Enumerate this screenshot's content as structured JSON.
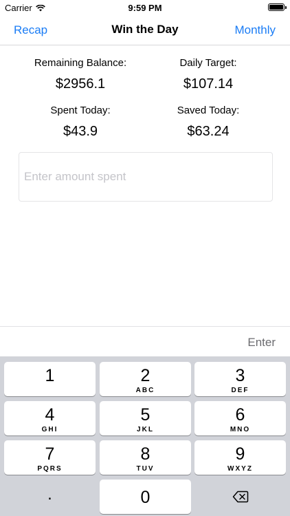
{
  "status_bar": {
    "carrier": "Carrier",
    "time": "9:59 PM"
  },
  "nav": {
    "left_label": "Recap",
    "title": "Win the Day",
    "right_label": "Monthly"
  },
  "stats": {
    "remaining_label": "Remaining Balance:",
    "remaining_value": "$2956.1",
    "target_label": "Daily Target:",
    "target_value": "$107.14",
    "spent_label": "Spent Today:",
    "spent_value": "$43.9",
    "saved_label": "Saved Today:",
    "saved_value": "$63.24"
  },
  "input": {
    "placeholder": "Enter amount spent",
    "value": ""
  },
  "accessory": {
    "enter_label": "Enter"
  },
  "keypad": {
    "keys": [
      {
        "num": "1",
        "letters": ""
      },
      {
        "num": "2",
        "letters": "ABC"
      },
      {
        "num": "3",
        "letters": "DEF"
      },
      {
        "num": "4",
        "letters": "GHI"
      },
      {
        "num": "5",
        "letters": "JKL"
      },
      {
        "num": "6",
        "letters": "MNO"
      },
      {
        "num": "7",
        "letters": "PQRS"
      },
      {
        "num": "8",
        "letters": "TUV"
      },
      {
        "num": "9",
        "letters": "WXYZ"
      }
    ],
    "dot": ".",
    "zero": "0",
    "backspace_icon": "backspace-icon"
  },
  "colors": {
    "accent": "#1a7cf5",
    "keypad_bg": "#d1d3d9",
    "key_bg": "#ffffff",
    "placeholder": "#c4c4c9"
  }
}
